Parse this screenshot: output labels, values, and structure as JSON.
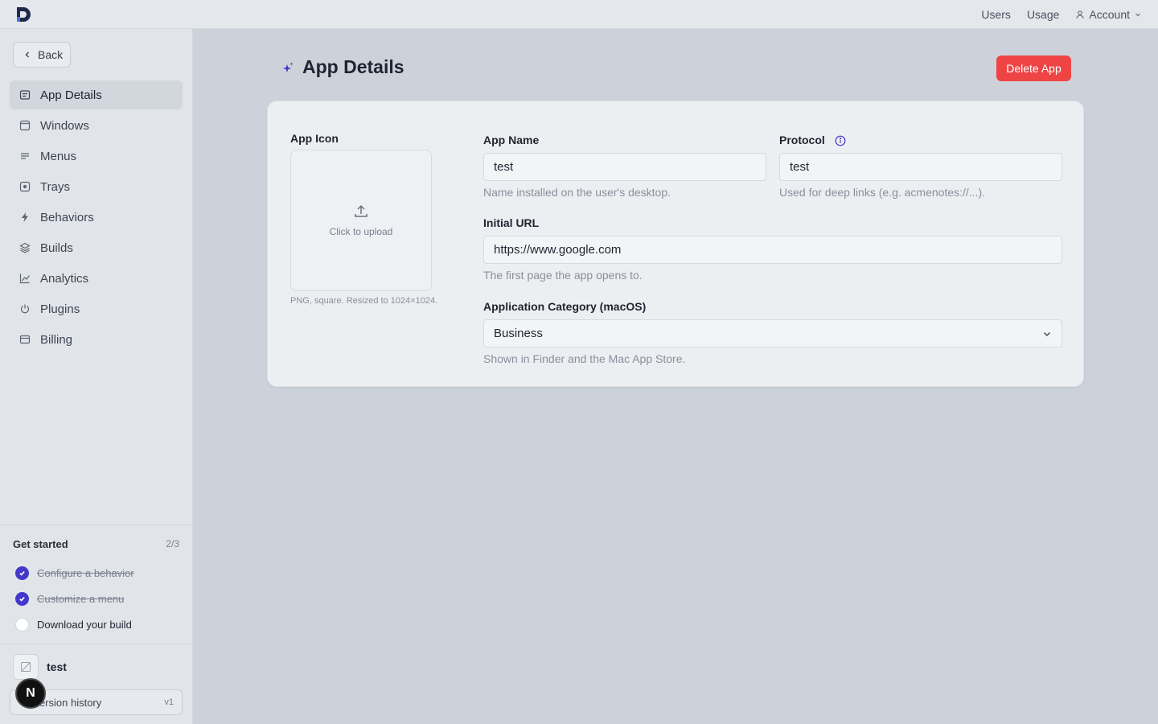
{
  "topbar": {
    "nav": [
      {
        "label": "Users"
      },
      {
        "label": "Usage"
      },
      {
        "label": "Account"
      }
    ]
  },
  "sidebar": {
    "back_label": "Back",
    "items": [
      {
        "label": "App Details",
        "icon": "details-icon",
        "active": true
      },
      {
        "label": "Windows",
        "icon": "window-icon"
      },
      {
        "label": "Menus",
        "icon": "menu-lines-icon"
      },
      {
        "label": "Trays",
        "icon": "tray-icon"
      },
      {
        "label": "Behaviors",
        "icon": "bolt-icon"
      },
      {
        "label": "Builds",
        "icon": "layers-icon"
      },
      {
        "label": "Analytics",
        "icon": "chart-icon"
      },
      {
        "label": "Plugins",
        "icon": "plug-icon"
      },
      {
        "label": "Billing",
        "icon": "card-icon"
      }
    ],
    "get_started": {
      "title": "Get started",
      "count": "2/3",
      "items": [
        {
          "label": "Configure a behavior",
          "done": true
        },
        {
          "label": "Customize a menu",
          "done": true
        },
        {
          "label": "Download your build",
          "done": false
        }
      ]
    },
    "app": {
      "name": "test",
      "version_label": "Version history",
      "version": "v1"
    },
    "badge": "N"
  },
  "main": {
    "title": "App Details",
    "delete_label": "Delete App",
    "icon_section": {
      "label": "App Icon",
      "upload_text": "Click to upload",
      "hint": "PNG, square. Resized to 1024×1024."
    },
    "app_name": {
      "label": "App Name",
      "value": "test",
      "hint": "Name installed on the user's desktop."
    },
    "protocol": {
      "label": "Protocol",
      "value": "test",
      "hint": "Used for deep links (e.g. acmenotes://...)."
    },
    "initial_url": {
      "label": "Initial URL",
      "value": "https://www.google.com",
      "hint": "The first page the app opens to."
    },
    "category": {
      "label": "Application Category (macOS)",
      "value": "Business",
      "hint": "Shown in Finder and the Mac App Store."
    }
  },
  "colors": {
    "accent": "#4338ca",
    "danger": "#ef4444"
  }
}
